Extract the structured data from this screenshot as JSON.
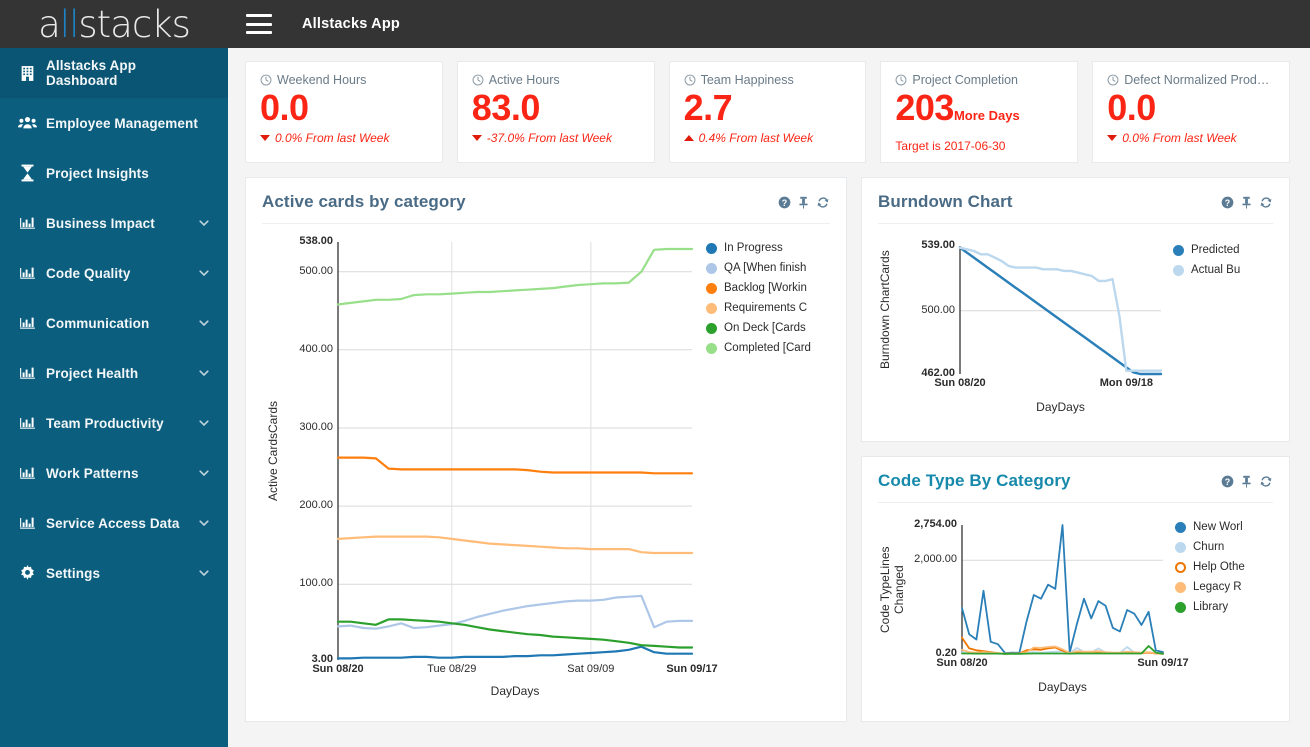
{
  "brand": {
    "text_a": "a",
    "text_b": "ll",
    "text_c": "stacks"
  },
  "topbar": {
    "title": "Allstacks App",
    "menu_icon": "hamburger-icon"
  },
  "sidebar": {
    "items": [
      {
        "label": "Allstacks App Dashboard",
        "icon": "building-icon",
        "active": true,
        "caret": false
      },
      {
        "label": "Employee Management",
        "icon": "users-icon",
        "active": false,
        "caret": false
      },
      {
        "label": "Project Insights",
        "icon": "hourglass-icon",
        "active": false,
        "caret": false
      },
      {
        "label": "Business Impact",
        "icon": "bar-chart-icon",
        "active": false,
        "caret": true
      },
      {
        "label": "Code Quality",
        "icon": "bar-chart-icon",
        "active": false,
        "caret": true
      },
      {
        "label": "Communication",
        "icon": "bar-chart-icon",
        "active": false,
        "caret": true
      },
      {
        "label": "Project Health",
        "icon": "bar-chart-icon",
        "active": false,
        "caret": true
      },
      {
        "label": "Team Productivity",
        "icon": "bar-chart-icon",
        "active": false,
        "caret": true
      },
      {
        "label": "Work Patterns",
        "icon": "bar-chart-icon",
        "active": false,
        "caret": true
      },
      {
        "label": "Service Access Data",
        "icon": "bar-chart-icon",
        "active": false,
        "caret": true
      },
      {
        "label": "Settings",
        "icon": "gear-icon",
        "active": false,
        "caret": true
      }
    ]
  },
  "kpis": [
    {
      "title": "Weekend Hours",
      "value": "0.0",
      "suffix": "",
      "delta": "0.0% From last Week",
      "direction": "down",
      "italic": true
    },
    {
      "title": "Active Hours",
      "value": "83.0",
      "suffix": "",
      "delta": "-37.0% From last Week",
      "direction": "down",
      "italic": true
    },
    {
      "title": "Team Happiness",
      "value": "2.7",
      "suffix": "",
      "delta": "0.4% From last Week",
      "direction": "up",
      "italic": true
    },
    {
      "title": "Project Completion",
      "value": "203",
      "suffix": "More Days",
      "delta": "Target is 2017-06-30",
      "direction": "none",
      "italic": false
    },
    {
      "title": "Defect Normalized Prod…",
      "value": "0.0",
      "suffix": "",
      "delta": "0.0% From last Week",
      "direction": "down",
      "italic": true
    }
  ],
  "panel_tools": [
    {
      "name": "help-icon",
      "glyph": "?"
    },
    {
      "name": "pin-icon",
      "glyph": "pin"
    },
    {
      "name": "refresh-icon",
      "glyph": "refresh"
    }
  ],
  "panels": {
    "active_cards": {
      "title": "Active cards by category",
      "title_color": "#4a6b85"
    },
    "burndown": {
      "title": "Burndown Chart",
      "title_color": "#4a6b85"
    },
    "code_type": {
      "title": "Code Type By Category",
      "title_color": "#1789ab"
    }
  },
  "chart_data": [
    {
      "id": "active_cards",
      "type": "line",
      "title": "Active cards by category",
      "xlabel": "DayDays",
      "ylabel": "Active CardsCards",
      "ylim": [
        3.0,
        538.0
      ],
      "ytick_labels": [
        "3.00",
        "100.00",
        "200.00",
        "300.00",
        "400.00",
        "500.00",
        "538.00"
      ],
      "ytick_values": [
        3,
        100,
        200,
        300,
        400,
        500,
        538
      ],
      "xtick_labels": [
        "Sun 08/20",
        "Tue 08/29",
        "Sat 09/09",
        "Sun 09/17"
      ],
      "xtick_positions": [
        0,
        9,
        20,
        28
      ],
      "x_count": 29,
      "grid": true,
      "legend_position": "right",
      "series": [
        {
          "name": "In Progress",
          "legend": "In Progress",
          "color": "#1f77b4",
          "values": [
            5,
            5,
            6,
            6,
            6,
            6,
            7,
            7,
            6,
            6,
            7,
            7,
            7,
            7,
            8,
            8,
            9,
            9,
            10,
            11,
            12,
            13,
            14,
            16,
            20,
            13,
            11,
            11,
            11
          ]
        },
        {
          "name": "QA [When finished]",
          "legend": "QA [When finish",
          "color": "#aec7e8",
          "values": [
            46,
            47,
            44,
            43,
            46,
            50,
            44,
            45,
            47,
            49,
            53,
            58,
            62,
            66,
            69,
            72,
            74,
            76,
            78,
            79,
            79,
            80,
            83,
            84,
            85,
            45,
            52,
            53,
            53
          ]
        },
        {
          "name": "Backlog [Working]",
          "legend": "Backlog [Workin",
          "color": "#ff7f0e",
          "values": [
            262,
            262,
            262,
            261,
            248,
            247,
            247,
            247,
            247,
            247,
            247,
            247,
            247,
            247,
            247,
            246,
            244,
            243,
            243,
            243,
            243,
            243,
            243,
            243,
            243,
            242,
            242,
            242,
            242
          ]
        },
        {
          "name": "Requirements Complete",
          "legend": "Requirements C",
          "color": "#ffbb78",
          "values": [
            158,
            159,
            160,
            161,
            161,
            161,
            161,
            161,
            160,
            158,
            156,
            154,
            152,
            151,
            150,
            149,
            148,
            147,
            146,
            146,
            145,
            145,
            145,
            145,
            141,
            140,
            140,
            140,
            140
          ]
        },
        {
          "name": "On Deck [Cards]",
          "legend": "On Deck [Cards",
          "color": "#2ca02c",
          "values": [
            52,
            52,
            50,
            48,
            55,
            55,
            54,
            53,
            52,
            50,
            48,
            45,
            42,
            40,
            38,
            36,
            35,
            33,
            32,
            31,
            30,
            29,
            27,
            25,
            22,
            21,
            20,
            19,
            19
          ]
        },
        {
          "name": "Completed [Cards]",
          "legend": "Completed [Card",
          "color": "#98df8a",
          "values": [
            458,
            460,
            462,
            464,
            464,
            465,
            470,
            471,
            471,
            472,
            473,
            474,
            474,
            475,
            476,
            477,
            478,
            479,
            481,
            483,
            484,
            485,
            485,
            486,
            500,
            528,
            529,
            529,
            529
          ]
        }
      ]
    },
    {
      "id": "burndown",
      "type": "line",
      "title": "Burndown Chart",
      "xlabel": "DayDays",
      "ylabel": "Burndown ChartCards",
      "ylim": [
        462.0,
        539.0
      ],
      "ytick_labels": [
        "462.00",
        "500.00",
        "539.00"
      ],
      "ytick_values": [
        462,
        500,
        539
      ],
      "xtick_labels": [
        "Sun 08/20",
        "Mon 09/18"
      ],
      "xtick_positions": [
        0,
        24
      ],
      "x_count": 30,
      "grid": true,
      "legend_position": "right",
      "series": [
        {
          "name": "Predicted",
          "legend": "Predicted",
          "color": "#2a7fb8",
          "values": [
            538,
            535,
            532,
            529,
            526,
            523,
            520,
            517,
            514,
            511,
            508,
            505,
            502,
            499,
            496,
            493,
            490,
            487,
            484,
            481,
            478,
            475,
            472,
            469,
            466,
            463,
            462,
            462,
            462,
            462
          ]
        },
        {
          "name": "Actual Burndown",
          "legend": "Actual Bu",
          "color": "#bcd8ee",
          "values": [
            538,
            537,
            536,
            534,
            534,
            532,
            530,
            527,
            526,
            526,
            526,
            526,
            525,
            525,
            525,
            524,
            524,
            523,
            522,
            521,
            518,
            518,
            519,
            497,
            464,
            464,
            464,
            464,
            464,
            464
          ]
        }
      ]
    },
    {
      "id": "code_type",
      "type": "line",
      "title": "Code Type By Category",
      "xlabel": "DayDays",
      "ylabel": "Code TypeLines Changed",
      "ylim": [
        0.2,
        2754.0
      ],
      "ytick_labels": [
        "0.20",
        "2,000.00",
        "2,754.00"
      ],
      "ytick_values": [
        0.2,
        2000,
        2754
      ],
      "xtick_labels": [
        "Sun 08/20",
        "Sun 09/17"
      ],
      "xtick_positions": [
        0,
        28
      ],
      "x_count": 29,
      "grid": true,
      "legend_position": "right",
      "series": [
        {
          "name": "New Work",
          "legend": "New Worl",
          "color": "#2a7fb8",
          "values": [
            980,
            420,
            310,
            1350,
            260,
            210,
            20,
            30,
            25,
            700,
            1260,
            1180,
            1480,
            1390,
            2754,
            30,
            640,
            1180,
            760,
            1130,
            1030,
            560,
            480,
            940,
            860,
            620,
            900,
            80,
            40
          ]
        },
        {
          "name": "Churn",
          "legend": "Churn",
          "color": "#bcd8ee",
          "values": [
            40,
            20,
            15,
            25,
            20,
            10,
            5,
            10,
            10,
            30,
            40,
            30,
            40,
            50,
            60,
            10,
            130,
            40,
            30,
            120,
            30,
            20,
            20,
            150,
            30,
            20,
            30,
            10,
            5
          ]
        },
        {
          "name": "Help Others",
          "legend": "Help Othe",
          "color": "#ee7600",
          "values": [
            350,
            120,
            80,
            60,
            40,
            20,
            5,
            10,
            10,
            80,
            100,
            90,
            120,
            140,
            70,
            20,
            40,
            30,
            30,
            40,
            30,
            20,
            20,
            30,
            30,
            20,
            30,
            10,
            5
          ]
        },
        {
          "name": "Legacy Refactor",
          "legend": "Legacy R",
          "color": "#ffbb78",
          "values": [
            90,
            40,
            30,
            40,
            30,
            20,
            5,
            10,
            10,
            40,
            140,
            130,
            150,
            160,
            100,
            20,
            60,
            50,
            50,
            60,
            40,
            30,
            30,
            50,
            40,
            30,
            40,
            15,
            8
          ]
        },
        {
          "name": "Library",
          "legend": "Library",
          "color": "#2ca02c",
          "values": [
            10,
            10,
            8,
            8,
            8,
            8,
            5,
            5,
            5,
            8,
            10,
            10,
            10,
            10,
            10,
            8,
            10,
            10,
            10,
            10,
            10,
            10,
            10,
            10,
            10,
            10,
            170,
            30,
            6
          ]
        }
      ]
    }
  ]
}
